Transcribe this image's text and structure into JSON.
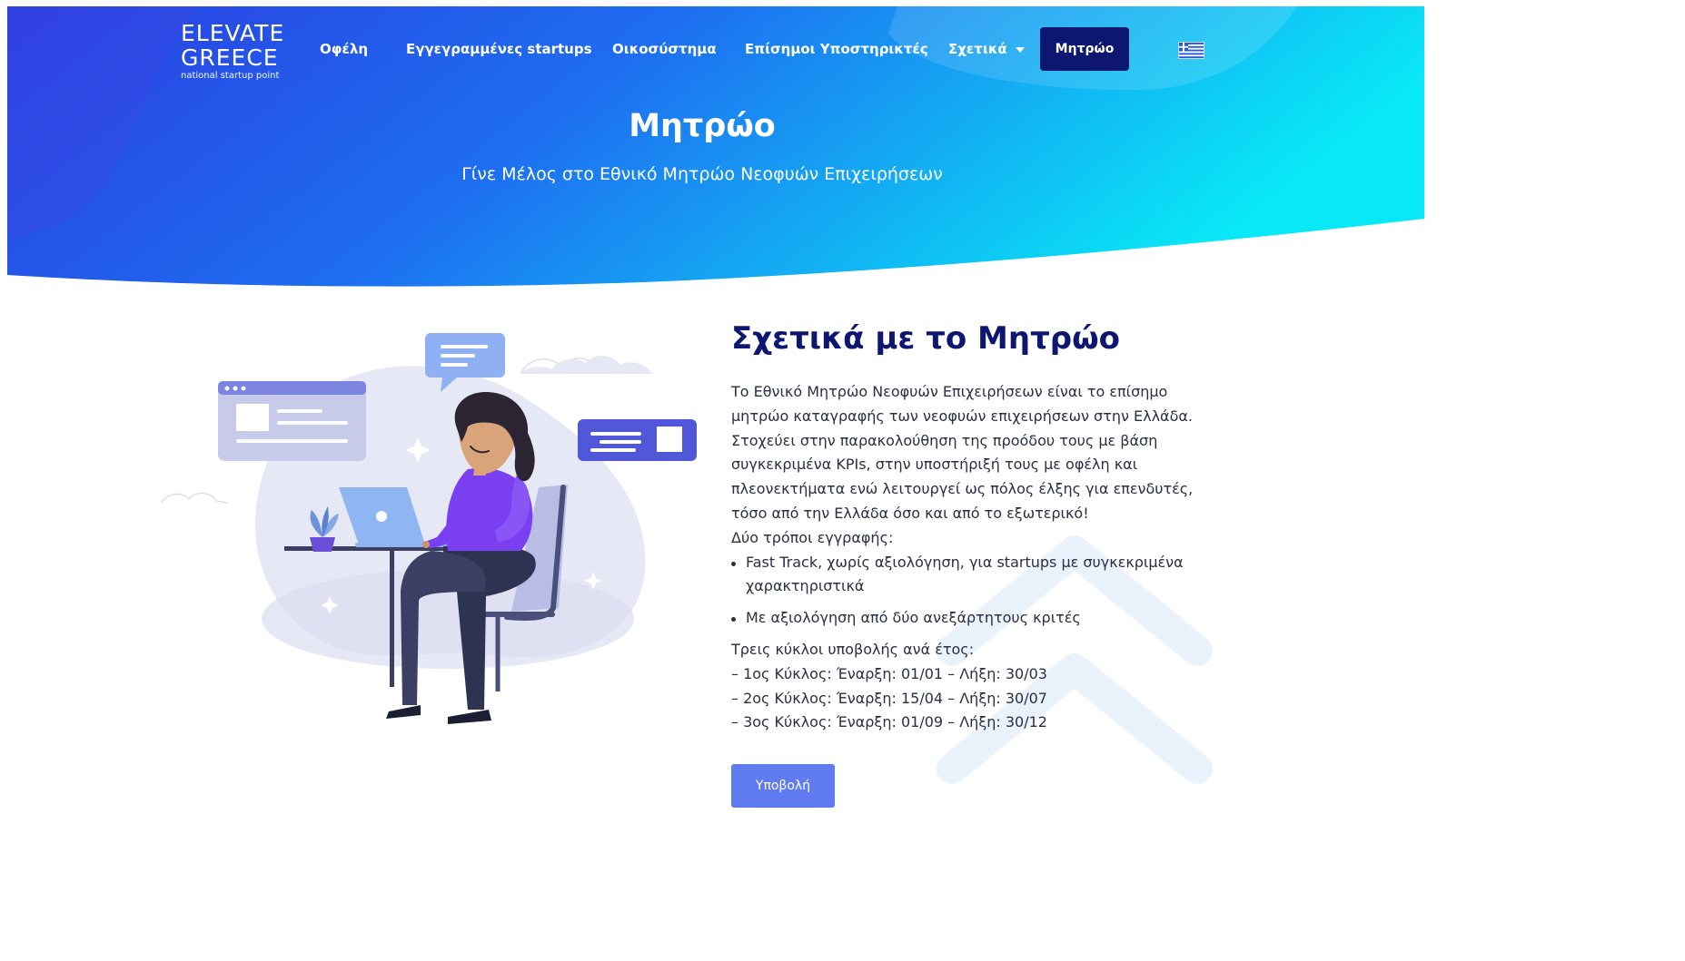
{
  "logo": {
    "line1": "ELEVATE",
    "line2": "GREECE",
    "tagline": "national startup point"
  },
  "nav": {
    "items": [
      {
        "label": "Οφέλη"
      },
      {
        "label": "Εγγεγραμμένες startups"
      },
      {
        "label": "Οικοσύστημα"
      },
      {
        "label": "Επίσημοι Υποστηρικτές"
      },
      {
        "label": "Σχετικά"
      }
    ],
    "cta_label": "Μητρώο",
    "language_icon": "greek-flag-icon"
  },
  "hero": {
    "title": "Μητρώο",
    "subtitle": "Γίνε Μέλος στο Εθνικό Μητρώο Νεοφυών Επιχειρήσεων"
  },
  "about": {
    "title": "Σχετικά με το Μητρώο",
    "paragraph": "Το Εθνικό Μητρώο Νεοφυών Επιχειρήσεων είναι το επίσημο μητρώο καταγραφής των νεοφυών επιχειρήσεων στην Ελλάδα. Στοχεύει στην παρακολούθηση της  προόδου τους με βάση συγκεκριμένα KPIs, στην υποστήριξή τους με οφέλη και πλεονεκτήματα ενώ λειτουργεί ως πόλος έλξης για επενδυτές, τόσο από την Ελλάδα όσο και από το εξωτερικό!",
    "methods_heading": "Δύο τρόποι εγγραφής:",
    "methods": [
      {
        "text": "Fast Track, χωρίς αξιολόγηση, για startups με συγκεκριμένα χαρακτηριστικά"
      },
      {
        "text": "Με αξιολόγηση από δύο ανεξάρτητους κριτές"
      }
    ],
    "cycles_heading": "Τρεις κύκλοι υποβολής ανά έτος:",
    "cycles": [
      {
        "text": "– 1ος Κύκλος: Έναρξη: 01/01 – Λήξη: 30/03"
      },
      {
        "text": "– 2ος Κύκλος: Έναρξη: 15/04 – Λήξη: 30/07"
      },
      {
        "text": "– 3ος Κύκλος: Έναρξη: 01/09 – Λήξη: 30/12"
      }
    ],
    "submit_label": "Υποβολή"
  },
  "colors": {
    "hero_gradient_start": "#2c3fe0",
    "hero_gradient_end": "#0ce6f5",
    "nav_cta_bg": "#0d1670",
    "title_color": "#0d1670",
    "submit_bg": "#5f7bef"
  },
  "illustration": "woman-working-on-laptop-illustration"
}
